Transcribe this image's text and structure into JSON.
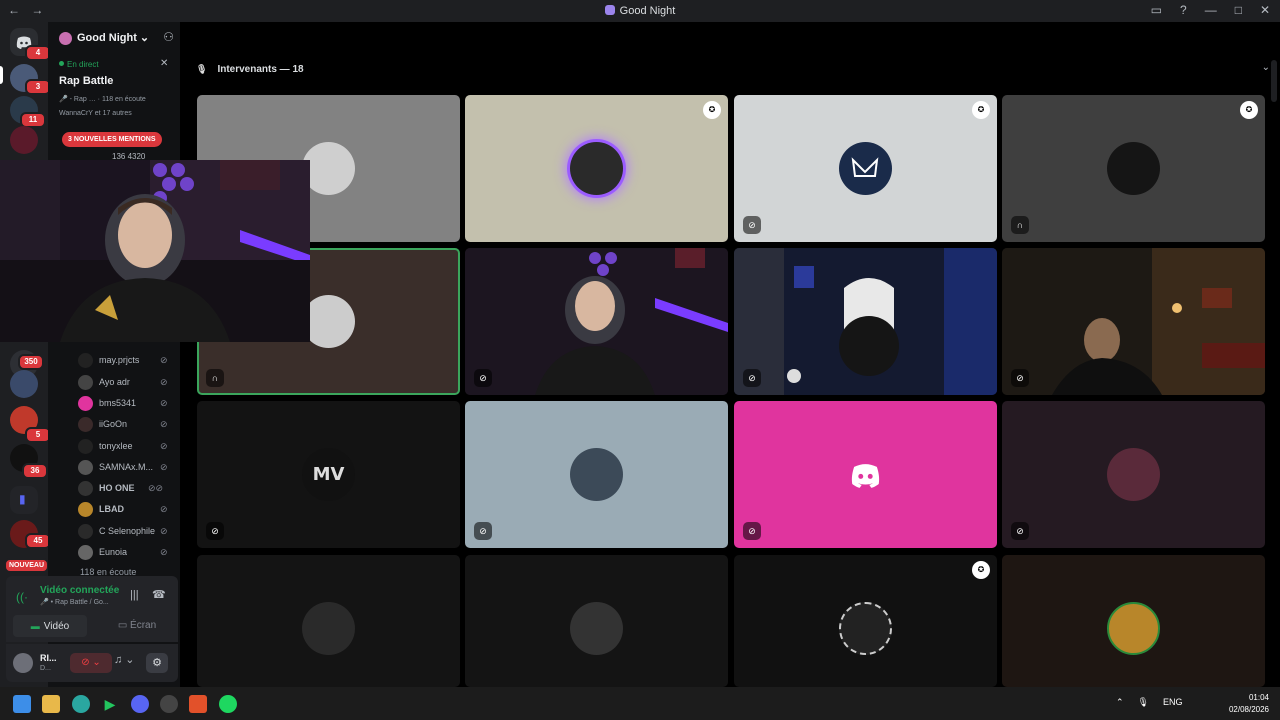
{
  "window": {
    "title": "Good Night"
  },
  "rail": {
    "badges": [
      "4",
      "3",
      "11",
      "350",
      "5",
      "36",
      "45"
    ],
    "new_label": "NOUVEAU"
  },
  "server": {
    "name": "Good Night"
  },
  "stage": {
    "live_label": "En direct",
    "name": "Rap Battle",
    "sub": "🎤 - Rap …  ·  118 en écoute",
    "audience": "WannaCrY et 17 autres",
    "new_mentions": "3 NOUVELLES MENTIONS",
    "counts": "136   4320"
  },
  "members": [
    {
      "name": "may.prjcts"
    },
    {
      "name": "Ayo adr"
    },
    {
      "name": "bms5341"
    },
    {
      "name": "iiGoOn"
    },
    {
      "name": "tonyxlee"
    },
    {
      "name": "SAMNAx.M..."
    },
    {
      "name": "HO ONE"
    },
    {
      "name": "LBAD"
    },
    {
      "name": "C Selenophile"
    },
    {
      "name": "Eunoia"
    }
  ],
  "listeners": "118 en écoute",
  "voice": {
    "status": "Vidéo connectée",
    "channel": "🎤 • Rap Battle / Go...",
    "video_btn": "Vidéo",
    "screen_btn": "Écran"
  },
  "user": {
    "name": "RI...",
    "status": "D..."
  },
  "main": {
    "speakers_label": "Intervenants — 18"
  },
  "tiles_colors": {
    "grey": "#828282",
    "beige": "#c3c0ad",
    "lightgrey": "#d2d5d6",
    "darkgrey": "#3f3f3f",
    "brown": "#3a2e2a",
    "dark": "#131313",
    "bluegrey": "#9aabb5",
    "pink": "#e0349e",
    "plum": "#251a22"
  },
  "taskbar": {
    "lang": "ENG",
    "time": "01:04",
    "date": "02/08/2026"
  }
}
